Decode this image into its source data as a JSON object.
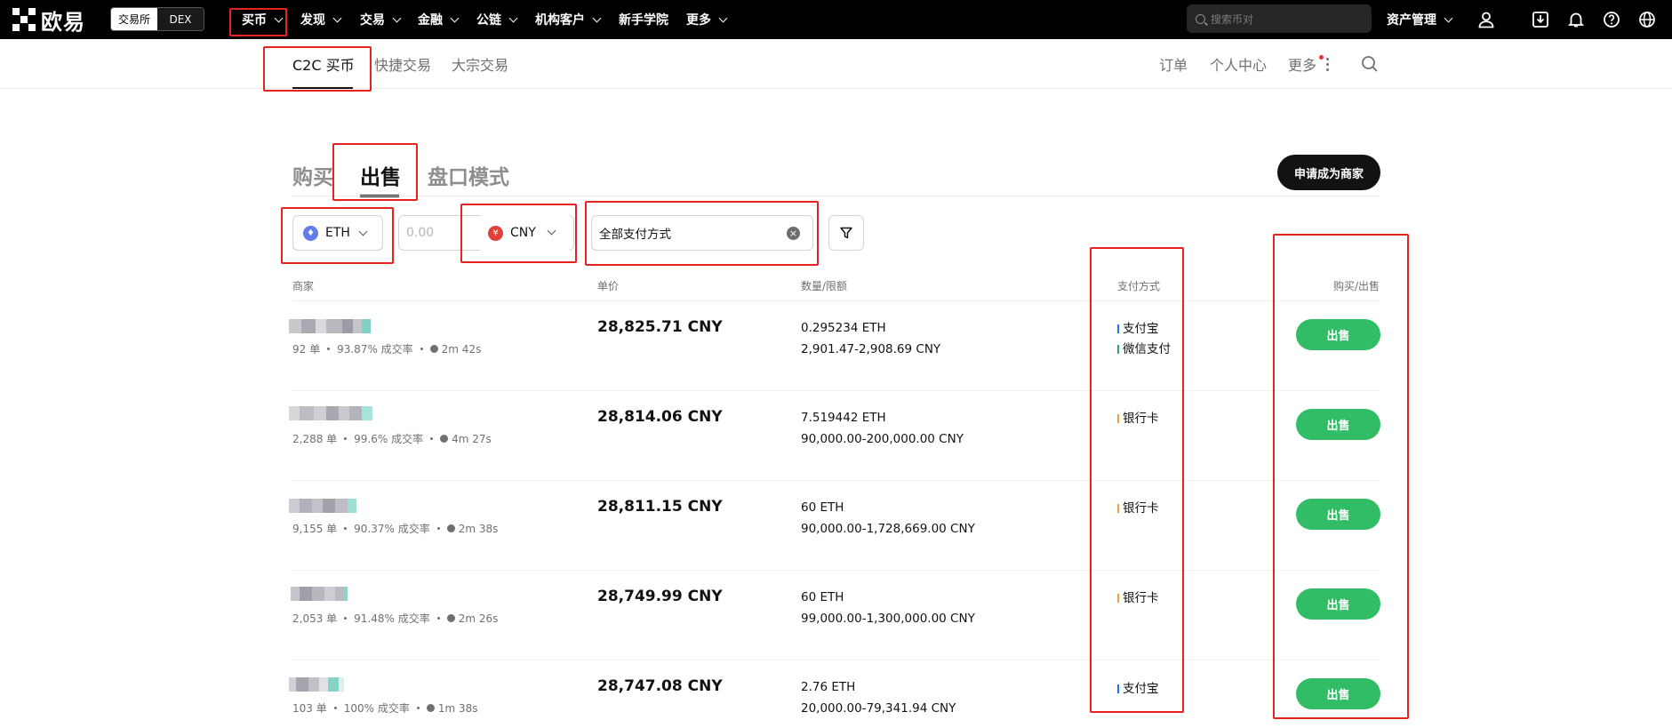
{
  "topnav": {
    "logo_text": "欧易",
    "segment": [
      "交易所",
      "DEX"
    ],
    "menu": [
      "买币",
      "发现",
      "交易",
      "金融",
      "公链",
      "机构客户",
      "新手学院",
      "更多"
    ],
    "search_placeholder": "搜索币对",
    "assets_label": "资产管理"
  },
  "subnav": {
    "tabs": [
      "C2C 买币",
      "快捷交易",
      "大宗交易"
    ],
    "right": [
      "订单",
      "个人中心",
      "更多"
    ]
  },
  "main": {
    "tabs": [
      "购买",
      "出售",
      "盘口模式"
    ],
    "merchant_button": "申请成为商家"
  },
  "filters": {
    "coin": "ETH",
    "amount_placeholder": "0.00",
    "currency": "CNY",
    "payment": "全部支付方式"
  },
  "table": {
    "headers": [
      "商家",
      "单价",
      "数量/限额",
      "支付方式",
      "购买/出售"
    ],
    "rows": [
      {
        "orders": "92 单",
        "rate": "93.87% 成交率",
        "time": "2m 42s",
        "price": "28,825.71 CNY",
        "qty": "0.295234 ETH",
        "limit": "2,901.47-2,908.69 CNY",
        "payments": [
          {
            "name": "支付宝",
            "color": "#1677ff"
          },
          {
            "name": "微信支付",
            "color": "#2aae67"
          }
        ],
        "action": "出售"
      },
      {
        "orders": "2,288 单",
        "rate": "99.6% 成交率",
        "time": "4m 27s",
        "price": "28,814.06 CNY",
        "qty": "7.519442 ETH",
        "limit": "90,000.00-200,000.00 CNY",
        "payments": [
          {
            "name": "银行卡",
            "color": "#f0a23b"
          }
        ],
        "action": "出售"
      },
      {
        "orders": "9,155 单",
        "rate": "90.37% 成交率",
        "time": "2m 38s",
        "price": "28,811.15 CNY",
        "qty": "60 ETH",
        "limit": "90,000.00-1,728,669.00 CNY",
        "payments": [
          {
            "name": "银行卡",
            "color": "#f0a23b"
          }
        ],
        "action": "出售"
      },
      {
        "orders": "2,053 单",
        "rate": "91.48% 成交率",
        "time": "2m 26s",
        "price": "28,749.99 CNY",
        "qty": "60 ETH",
        "limit": "99,000.00-1,300,000.00 CNY",
        "payments": [
          {
            "name": "银行卡",
            "color": "#f0a23b"
          }
        ],
        "action": "出售"
      },
      {
        "orders": "103 单",
        "rate": "100% 成交率",
        "time": "1m 38s",
        "price": "28,747.08 CNY",
        "qty": "2.76 ETH",
        "limit": "20,000.00-79,341.94 CNY",
        "payments": [
          {
            "name": "支付宝",
            "color": "#1677ff"
          }
        ],
        "action": "出售"
      }
    ]
  },
  "colors": {
    "sell_green": "#31bd65",
    "annotation_red": "#e8231f",
    "eth_blue": "#627eea",
    "cny_red": "#e0403a"
  }
}
